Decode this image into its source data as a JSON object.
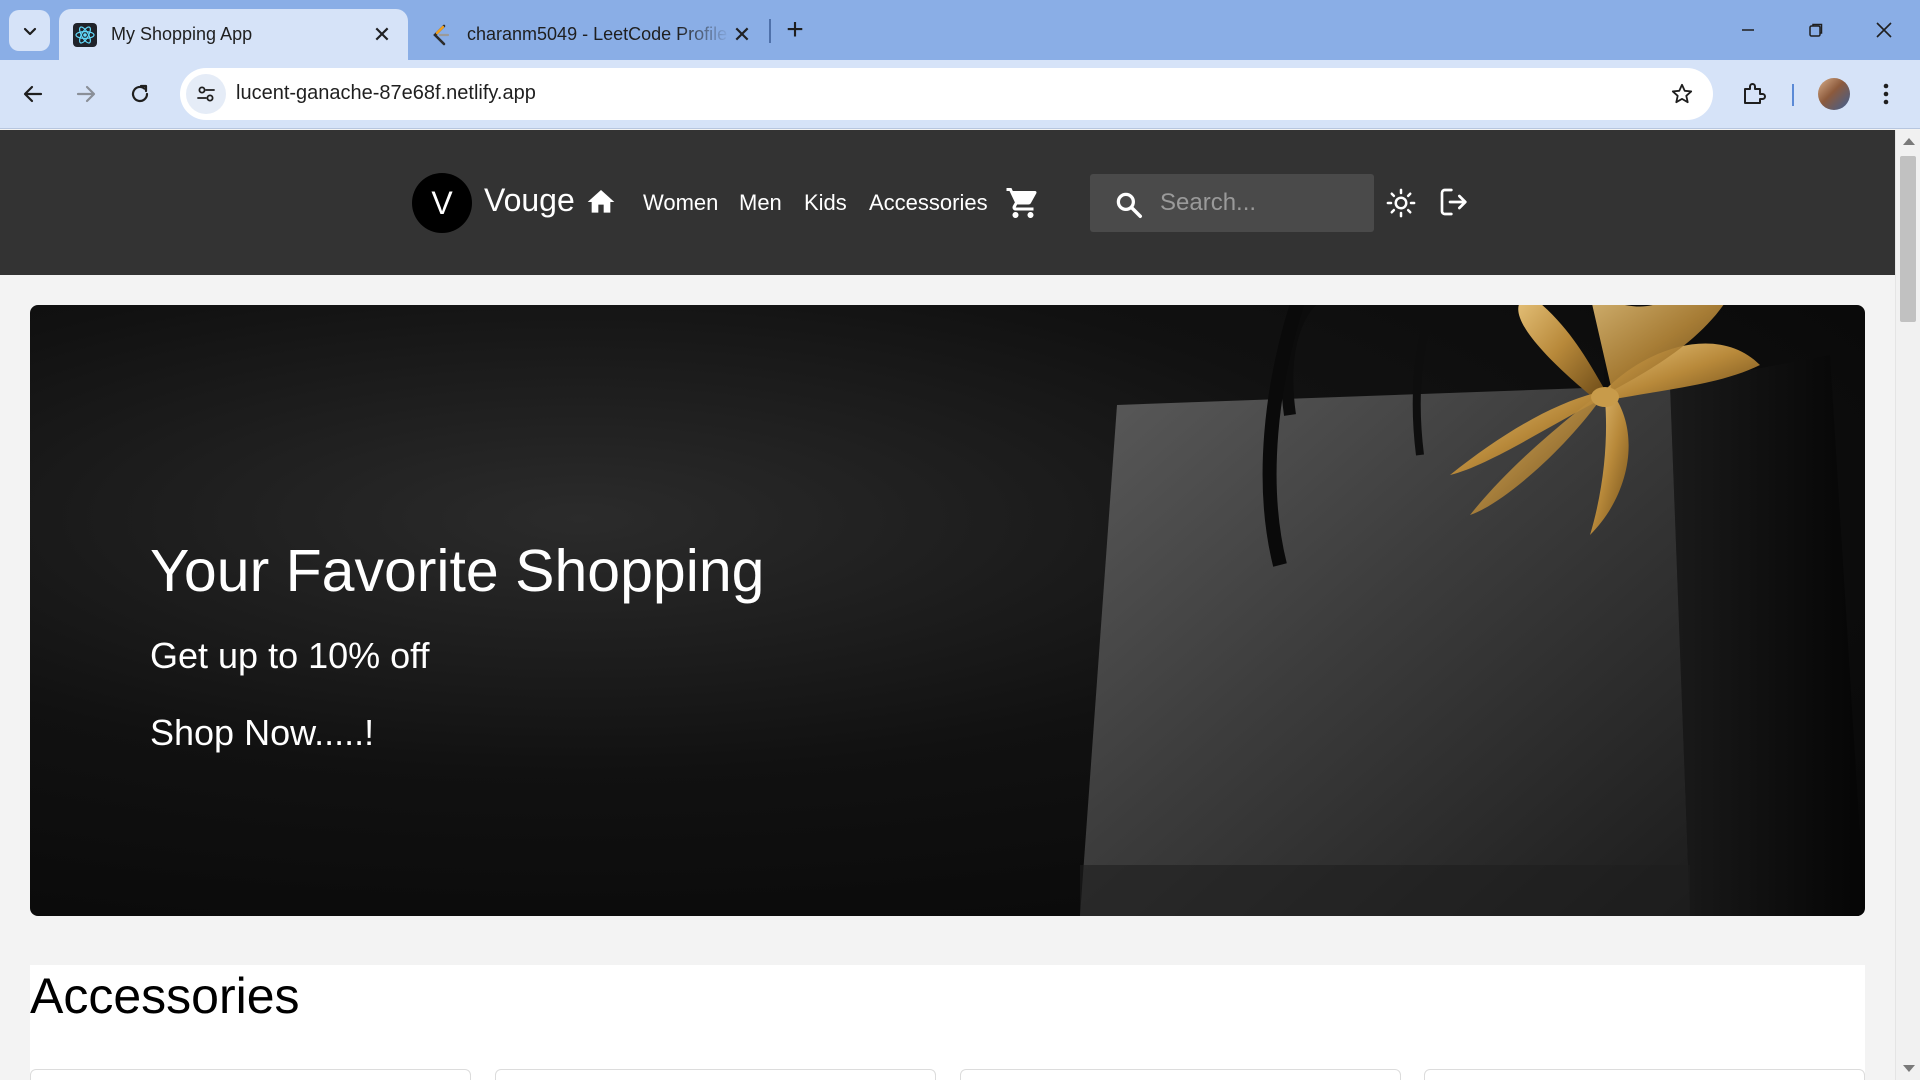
{
  "browser": {
    "tabs": [
      {
        "title": "My Shopping App",
        "active": true
      },
      {
        "title": "charanm5049 - LeetCode Profile",
        "active": false
      }
    ],
    "url": "lucent-ganache-87e68f.netlify.app"
  },
  "site": {
    "logo_letter": "V",
    "brand": "Vouge",
    "nav": [
      "Women",
      "Men",
      "Kids",
      "Accessories"
    ],
    "search_placeholder": "Search..."
  },
  "hero": {
    "title": "Your Favorite Shopping",
    "subtitle": "Get up to 10% off",
    "cta": "Shop Now.....!"
  },
  "section": {
    "title": "Accessories"
  },
  "colors": {
    "tabstrip": "#8aaee6",
    "toolbar": "#d6e3f8",
    "header": "#333333",
    "ribbon_gold": "#b8893a"
  }
}
